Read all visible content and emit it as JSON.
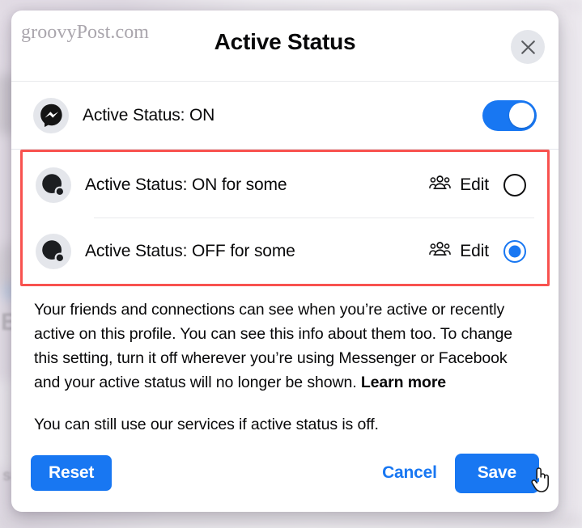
{
  "watermark": "groovyPost.com",
  "header": {
    "title": "Active Status",
    "close_label": "Close",
    "close_icon": "close-x-icon"
  },
  "colors": {
    "accent_blue": "#1877f2",
    "highlight_red": "#f8524f",
    "avatar_bg": "#e4e6eb",
    "text": "#080809"
  },
  "rows": [
    {
      "id": "active-status-on",
      "label": "Active Status: ON",
      "avatar_icon": "messenger-logo-icon",
      "control": "toggle",
      "toggle_on": true
    },
    {
      "id": "active-status-on-for-some",
      "label": "Active Status: ON for some",
      "avatar_icon": "partial-audience-icon",
      "edit_label": "Edit",
      "edit_icon": "people-group-icon",
      "control": "radio",
      "selected": false
    },
    {
      "id": "active-status-off-for-some",
      "label": "Active Status: OFF for some",
      "avatar_icon": "partial-audience-icon",
      "edit_label": "Edit",
      "edit_icon": "people-group-icon",
      "control": "radio",
      "selected": true
    }
  ],
  "body": {
    "paragraph_one_part_one": "Your friends and connections can see when you’re active or recently active on this profile. You can see this info about them too. To change this setting, turn it off wherever you’re using Messenger or Facebook and your active status will no longer be shown. ",
    "learn_more": "Learn more",
    "paragraph_two": "You can still use our services if active status is off."
  },
  "footer": {
    "reset_label": "Reset",
    "cancel_label": "Cancel",
    "save_label": "Save"
  }
}
